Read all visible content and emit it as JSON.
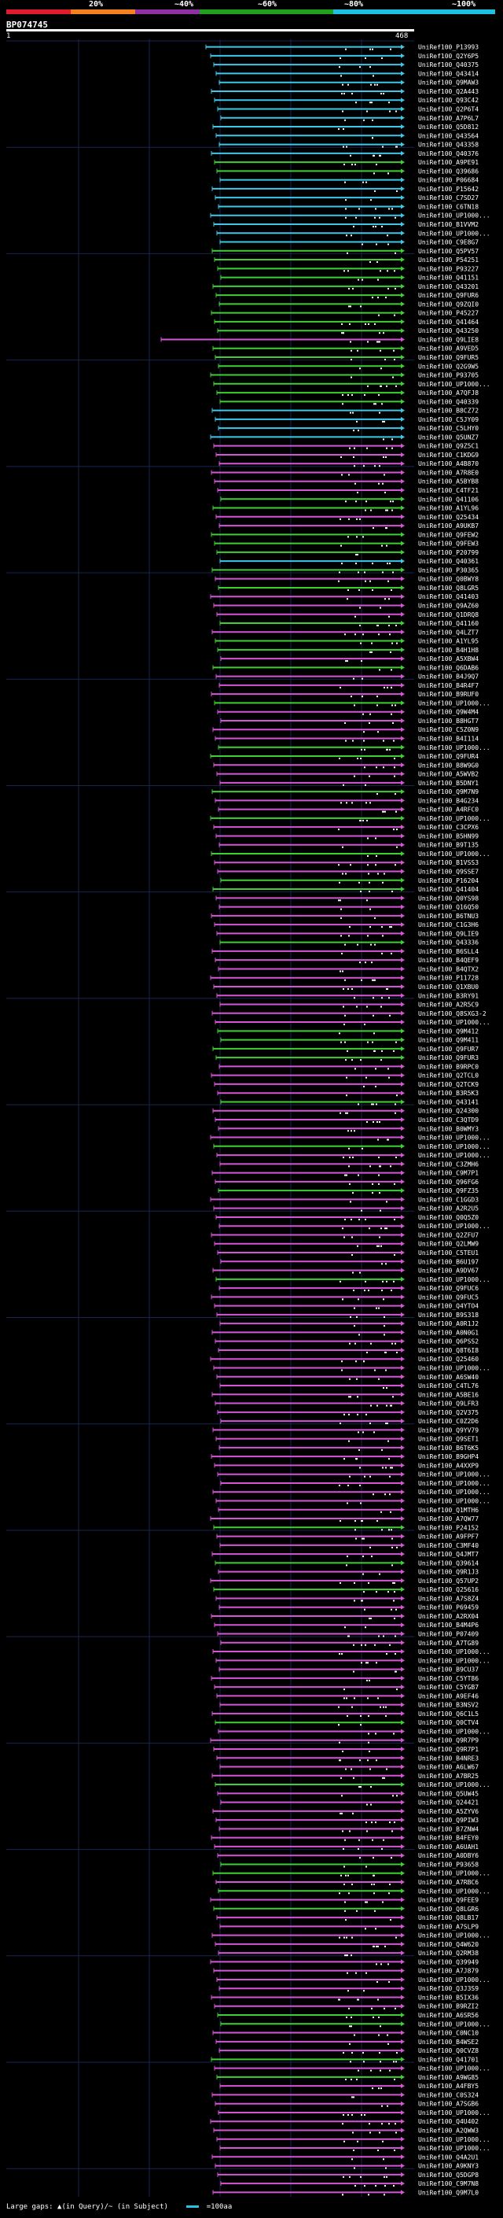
{
  "header": {
    "scale": [
      {
        "label": "20%",
        "color": "#e01b2c"
      },
      {
        "label": "~40%",
        "color": "#f58020"
      },
      {
        "label": "~60%",
        "color": "#8e2fa3"
      },
      {
        "label": "~80%",
        "color": "#1fa01f"
      },
      {
        "label": "~100%",
        "color": "#1ec0e0"
      }
    ],
    "title": "BP074745",
    "ruler_start": "1",
    "ruler_end": "468"
  },
  "colors": {
    "cyan": "#3cc8e8",
    "green": "#3ecf32",
    "magenta": "#d654d6",
    "background": "#000000",
    "grid": "#1a2550"
  },
  "legend": {
    "large_gaps": "Large gaps: ▲(in Query)/~ (in Subject)",
    "scale_text": "=100aa"
  },
  "hits": [
    {
      "label": "UniRef100_P13993",
      "c": "cyan"
    },
    {
      "label": "UniRef100_Q2Y6P5",
      "c": "cyan"
    },
    {
      "label": "UniRef100_Q40375",
      "c": "cyan"
    },
    {
      "label": "UniRef100_Q43414",
      "c": "cyan"
    },
    {
      "label": "UniRef100_Q9MAW3",
      "c": "cyan"
    },
    {
      "label": "UniRef100_Q2A443",
      "c": "cyan"
    },
    {
      "label": "UniRef100_Q93C42",
      "c": "cyan"
    },
    {
      "label": "UniRef100_Q2P6T4",
      "c": "cyan"
    },
    {
      "label": "UniRef100_A7P6L7",
      "c": "cyan"
    },
    {
      "label": "UniRef100_Q5D812",
      "c": "cyan"
    },
    {
      "label": "UniRef100_Q43564",
      "c": "cyan"
    },
    {
      "label": "UniRef100_Q43358",
      "c": "cyan"
    },
    {
      "label": "UniRef100_Q40376",
      "c": "cyan"
    },
    {
      "label": "UniRef100_A9PE91",
      "c": "green"
    },
    {
      "label": "UniRef100_Q39686",
      "c": "green"
    },
    {
      "label": "UniRef100_P06684",
      "c": "cyan"
    },
    {
      "label": "UniRef100_P15642",
      "c": "cyan"
    },
    {
      "label": "UniRef100_C7SD27",
      "c": "cyan"
    },
    {
      "label": "UniRef100_C6TN18",
      "c": "cyan"
    },
    {
      "label": "UniRef100_UP1000...",
      "c": "cyan"
    },
    {
      "label": "UniRef100_B1VVM2",
      "c": "cyan"
    },
    {
      "label": "UniRef100_UP1000...",
      "c": "cyan"
    },
    {
      "label": "UniRef100_C9E8G7",
      "c": "cyan"
    },
    {
      "label": "UniRef100_Q5PV57",
      "c": "green"
    },
    {
      "label": "UniRef100_P54251",
      "c": "green"
    },
    {
      "label": "UniRef100_P93227",
      "c": "green"
    },
    {
      "label": "UniRef100_Q41151",
      "c": "green"
    },
    {
      "label": "UniRef100_Q43201",
      "c": "green"
    },
    {
      "label": "UniRef100_Q9FUR6",
      "c": "green"
    },
    {
      "label": "UniRef100_Q9ZQI0",
      "c": "green"
    },
    {
      "label": "UniRef100_P45227",
      "c": "green"
    },
    {
      "label": "UniRef100_Q41464",
      "c": "green"
    },
    {
      "label": "UniRef100_Q43250",
      "c": "green"
    },
    {
      "label": "UniRef100_Q9LIE8",
      "c": "magenta"
    },
    {
      "label": "UniRef100_A9VED5",
      "c": "green"
    },
    {
      "label": "UniRef100_Q9FUR5",
      "c": "green"
    },
    {
      "label": "UniRef100_Q2G9W5",
      "c": "green"
    },
    {
      "label": "UniRef100_P93705",
      "c": "green"
    },
    {
      "label": "UniRef100_UP1000...",
      "c": "green"
    },
    {
      "label": "UniRef100_A7QFJ8",
      "c": "green"
    },
    {
      "label": "UniRef100_Q40339",
      "c": "green"
    },
    {
      "label": "UniRef100_B8CZ72",
      "c": "cyan"
    },
    {
      "label": "UniRef100_C5JY09",
      "c": "cyan"
    },
    {
      "label": "UniRef100_C5LHY0",
      "c": "cyan"
    },
    {
      "label": "UniRef100_Q5UNZ7",
      "c": "cyan"
    },
    {
      "label": "UniRef100_Q9Z5C1",
      "c": "magenta"
    },
    {
      "label": "UniRef100_C1KDG9",
      "c": "magenta"
    },
    {
      "label": "UniRef100_A4B870",
      "c": "magenta"
    },
    {
      "label": "UniRef100_A7R8E0",
      "c": "magenta"
    },
    {
      "label": "UniRef100_A5BYB8",
      "c": "magenta"
    },
    {
      "label": "UniRef100_C4TF21",
      "c": "magenta"
    },
    {
      "label": "UniRef100_Q41106",
      "c": "green"
    },
    {
      "label": "UniRef100_A1YL96",
      "c": "green"
    },
    {
      "label": "UniRef100_Q25434",
      "c": "magenta"
    },
    {
      "label": "UniRef100_A9UKB7",
      "c": "magenta"
    },
    {
      "label": "UniRef100_Q9FEW2",
      "c": "green"
    },
    {
      "label": "UniRef100_Q9FEW3",
      "c": "green"
    },
    {
      "label": "UniRef100_P20799",
      "c": "green"
    },
    {
      "label": "UniRef100_Q40361",
      "c": "cyan"
    },
    {
      "label": "UniRef100_P30365",
      "c": "green"
    },
    {
      "label": "UniRef100_Q0BWY8",
      "c": "magenta"
    },
    {
      "label": "UniRef100_Q8LGR5",
      "c": "green"
    },
    {
      "label": "UniRef100_Q41403",
      "c": "magenta"
    },
    {
      "label": "UniRef100_Q9AZ60",
      "c": "magenta"
    },
    {
      "label": "UniRef100_Q1DRQ8",
      "c": "magenta"
    },
    {
      "label": "UniRef100_Q41160",
      "c": "green"
    },
    {
      "label": "UniRef100_Q4LZT7",
      "c": "magenta"
    },
    {
      "label": "UniRef100_A1YL95",
      "c": "green"
    },
    {
      "label": "UniRef100_B4H1H8",
      "c": "green"
    },
    {
      "label": "UniRef100_A5XBW4",
      "c": "magenta"
    },
    {
      "label": "UniRef100_Q6DAB6",
      "c": "green"
    },
    {
      "label": "UniRef100_B4J9Q7",
      "c": "magenta"
    },
    {
      "label": "UniRef100_B4R4F7",
      "c": "magenta"
    },
    {
      "label": "UniRef100_B9RUF0",
      "c": "magenta"
    },
    {
      "label": "UniRef100_UP1000...",
      "c": "green"
    },
    {
      "label": "UniRef100_Q9W4M4",
      "c": "magenta"
    },
    {
      "label": "UniRef100_B8HGT7",
      "c": "magenta"
    },
    {
      "label": "UniRef100_C5Z0N9",
      "c": "magenta"
    },
    {
      "label": "UniRef100_B4I114",
      "c": "magenta"
    },
    {
      "label": "UniRef100_UP1000...",
      "c": "green"
    },
    {
      "label": "UniRef100_Q9FUR4",
      "c": "green"
    },
    {
      "label": "UniRef100_B8W9G0",
      "c": "magenta"
    },
    {
      "label": "UniRef100_A5WVB2",
      "c": "magenta"
    },
    {
      "label": "UniRef100_B5DNY1",
      "c": "magenta"
    },
    {
      "label": "UniRef100_Q9M7N9",
      "c": "green"
    },
    {
      "label": "UniRef100_B4G234",
      "c": "magenta"
    },
    {
      "label": "UniRef100_A4RFC0",
      "c": "magenta"
    },
    {
      "label": "UniRef100_UP1000...",
      "c": "green"
    },
    {
      "label": "UniRef100_C3CPX6",
      "c": "magenta"
    },
    {
      "label": "UniRef100_B5HN99",
      "c": "magenta"
    },
    {
      "label": "UniRef100_B9T135",
      "c": "magenta"
    },
    {
      "label": "UniRef100_UP1000...",
      "c": "green"
    },
    {
      "label": "UniRef100_B1VSS3",
      "c": "magenta"
    },
    {
      "label": "UniRef100_Q9SSE7",
      "c": "magenta"
    },
    {
      "label": "UniRef100_P16204",
      "c": "green"
    },
    {
      "label": "UniRef100_Q41404",
      "c": "green"
    },
    {
      "label": "UniRef100_Q0YS98",
      "c": "magenta"
    },
    {
      "label": "UniRef100_Q16Q50",
      "c": "magenta"
    },
    {
      "label": "UniRef100_B6TNU3",
      "c": "magenta"
    },
    {
      "label": "UniRef100_C1G3H6",
      "c": "magenta"
    },
    {
      "label": "UniRef100_Q9LIE9",
      "c": "magenta"
    },
    {
      "label": "UniRef100_Q43336",
      "c": "green"
    },
    {
      "label": "UniRef100_B6SLL4",
      "c": "magenta"
    },
    {
      "label": "UniRef100_B4QEF9",
      "c": "magenta"
    },
    {
      "label": "UniRef100_B4QTX2",
      "c": "magenta"
    },
    {
      "label": "UniRef100_P11728",
      "c": "magenta"
    },
    {
      "label": "UniRef100_Q1XBU0",
      "c": "magenta"
    },
    {
      "label": "UniRef100_B3RY91",
      "c": "magenta"
    },
    {
      "label": "UniRef100_A2R5C9",
      "c": "magenta"
    },
    {
      "label": "UniRef100_Q8SXG3-2",
      "c": "magenta"
    },
    {
      "label": "UniRef100_UP1000...",
      "c": "magenta"
    },
    {
      "label": "UniRef100_Q9M412",
      "c": "green"
    },
    {
      "label": "UniRef100_Q9M411",
      "c": "green"
    },
    {
      "label": "UniRef100_Q9FUR7",
      "c": "green"
    },
    {
      "label": "UniRef100_Q9FUR3",
      "c": "green"
    },
    {
      "label": "UniRef100_B9RPC0",
      "c": "magenta"
    },
    {
      "label": "UniRef100_Q2TCL0",
      "c": "magenta"
    },
    {
      "label": "UniRef100_Q2TCK9",
      "c": "magenta"
    },
    {
      "label": "UniRef100_B3R5K3",
      "c": "magenta"
    },
    {
      "label": "UniRef100_Q43141",
      "c": "green"
    },
    {
      "label": "UniRef100_Q24300",
      "c": "magenta"
    },
    {
      "label": "UniRef100_C3QTD9",
      "c": "magenta"
    },
    {
      "label": "UniRef100_B0WMY3",
      "c": "magenta"
    },
    {
      "label": "UniRef100_UP1000...",
      "c": "magenta"
    },
    {
      "label": "UniRef100_UP1000...",
      "c": "green"
    },
    {
      "label": "UniRef100_UP1000...",
      "c": "magenta"
    },
    {
      "label": "UniRef100_C3ZMH6",
      "c": "magenta"
    },
    {
      "label": "UniRef100_C9M7P1",
      "c": "magenta"
    },
    {
      "label": "UniRef100_Q96FG6",
      "c": "magenta"
    },
    {
      "label": "UniRef100_Q9FZ35",
      "c": "green"
    },
    {
      "label": "UniRef100_C1GGD3",
      "c": "magenta"
    },
    {
      "label": "UniRef100_A2R2U5",
      "c": "magenta"
    },
    {
      "label": "UniRef100_Q0Q5Z0",
      "c": "magenta"
    },
    {
      "label": "UniRef100_UP1000...",
      "c": "magenta"
    },
    {
      "label": "UniRef100_Q2ZFU7",
      "c": "magenta"
    },
    {
      "label": "UniRef100_Q2LMW9",
      "c": "magenta"
    },
    {
      "label": "UniRef100_C5TEU1",
      "c": "magenta"
    },
    {
      "label": "UniRef100_B6U197",
      "c": "magenta"
    },
    {
      "label": "UniRef100_A9DV67",
      "c": "magenta"
    },
    {
      "label": "UniRef100_UP1000...",
      "c": "green"
    },
    {
      "label": "UniRef100_Q9FUC6",
      "c": "magenta"
    },
    {
      "label": "UniRef100_Q9FUC5",
      "c": "magenta"
    },
    {
      "label": "UniRef100_Q4YTO4",
      "c": "magenta"
    },
    {
      "label": "UniRef100_B9S318",
      "c": "magenta"
    },
    {
      "label": "UniRef100_A0R1J2",
      "c": "magenta"
    },
    {
      "label": "UniRef100_A0N0G1",
      "c": "magenta"
    },
    {
      "label": "UniRef100_Q6PSS2",
      "c": "magenta"
    },
    {
      "label": "UniRef100_Q8T6I8",
      "c": "magenta"
    },
    {
      "label": "UniRef100_Q25460",
      "c": "magenta"
    },
    {
      "label": "UniRef100_UP1000...",
      "c": "magenta"
    },
    {
      "label": "UniRef100_A6SW40",
      "c": "magenta"
    },
    {
      "label": "UniRef100_C4TL76",
      "c": "magenta"
    },
    {
      "label": "UniRef100_A5BE16",
      "c": "magenta"
    },
    {
      "label": "UniRef100_Q9LFR3",
      "c": "magenta"
    },
    {
      "label": "UniRef100_Q2V375",
      "c": "magenta"
    },
    {
      "label": "UniRef100_C0Z2D6",
      "c": "magenta"
    },
    {
      "label": "UniRef100_Q9YV79",
      "c": "magenta"
    },
    {
      "label": "UniRef100_Q9SET1",
      "c": "magenta"
    },
    {
      "label": "UniRef100_B6T6K5",
      "c": "magenta"
    },
    {
      "label": "UniRef100_B9GHP4",
      "c": "magenta"
    },
    {
      "label": "UniRef100_A4XXP9",
      "c": "magenta"
    },
    {
      "label": "UniRef100_UP1000...",
      "c": "magenta"
    },
    {
      "label": "UniRef100_UP1000...",
      "c": "magenta"
    },
    {
      "label": "UniRef100_UP1000...",
      "c": "magenta"
    },
    {
      "label": "UniRef100_UP1000...",
      "c": "magenta"
    },
    {
      "label": "UniRef100_Q1MTH6",
      "c": "magenta"
    },
    {
      "label": "UniRef100_A7QW77",
      "c": "magenta"
    },
    {
      "label": "UniRef100_P24152",
      "c": "green"
    },
    {
      "label": "UniRef100_A9FPF7",
      "c": "magenta"
    },
    {
      "label": "UniRef100_C3MF40",
      "c": "magenta"
    },
    {
      "label": "UniRef100_Q4JMT7",
      "c": "magenta"
    },
    {
      "label": "UniRef100_Q39614",
      "c": "green"
    },
    {
      "label": "UniRef100_Q9R1J3",
      "c": "magenta"
    },
    {
      "label": "UniRef100_Q57UP2",
      "c": "magenta"
    },
    {
      "label": "UniRef100_Q25616",
      "c": "green"
    },
    {
      "label": "UniRef100_A7S8Z4",
      "c": "magenta"
    },
    {
      "label": "UniRef100_P69459",
      "c": "magenta"
    },
    {
      "label": "UniRef100_A2RX04",
      "c": "magenta"
    },
    {
      "label": "UniRef100_B4M4P6",
      "c": "magenta"
    },
    {
      "label": "UniRef100_P07409",
      "c": "magenta"
    },
    {
      "label": "UniRef100_A7TG89",
      "c": "magenta"
    },
    {
      "label": "UniRef100_UP1000...",
      "c": "magenta"
    },
    {
      "label": "UniRef100_UP1000...",
      "c": "magenta"
    },
    {
      "label": "UniRef100_B9CU37",
      "c": "magenta"
    },
    {
      "label": "UniRef100_C5YT86",
      "c": "magenta"
    },
    {
      "label": "UniRef100_C5YGB7",
      "c": "magenta"
    },
    {
      "label": "UniRef100_A9EF46",
      "c": "magenta"
    },
    {
      "label": "UniRef100_B3NSV2",
      "c": "magenta"
    },
    {
      "label": "UniRef100_Q6C1L5",
      "c": "magenta"
    },
    {
      "label": "UniRef100_Q0CTV4",
      "c": "green"
    },
    {
      "label": "UniRef100_UP1000...",
      "c": "magenta"
    },
    {
      "label": "UniRef100_Q9R7P9",
      "c": "magenta"
    },
    {
      "label": "UniRef100_Q9R7P1",
      "c": "magenta"
    },
    {
      "label": "UniRef100_B4NRE3",
      "c": "magenta"
    },
    {
      "label": "UniRef100_A6LW67",
      "c": "magenta"
    },
    {
      "label": "UniRef100_A7BR25",
      "c": "magenta"
    },
    {
      "label": "UniRef100_UP1000...",
      "c": "green"
    },
    {
      "label": "UniRef100_Q5UW45",
      "c": "magenta"
    },
    {
      "label": "UniRef100_Q24421",
      "c": "magenta"
    },
    {
      "label": "UniRef100_A5ZYV6",
      "c": "magenta"
    },
    {
      "label": "UniRef100_Q9PIW3",
      "c": "magenta"
    },
    {
      "label": "UniRef100_B7ZNW4",
      "c": "magenta"
    },
    {
      "label": "UniRef100_B4FEY0",
      "c": "magenta"
    },
    {
      "label": "UniRef100_A6UAH1",
      "c": "magenta"
    },
    {
      "label": "UniRef100_A0DBY6",
      "c": "magenta"
    },
    {
      "label": "UniRef100_P93658",
      "c": "green"
    },
    {
      "label": "UniRef100_UP1000...",
      "c": "green"
    },
    {
      "label": "UniRef100_A7RBC6",
      "c": "magenta"
    },
    {
      "label": "UniRef100_UP1000...",
      "c": "green"
    },
    {
      "label": "UniRef100_Q9FEE9",
      "c": "magenta"
    },
    {
      "label": "UniRef100_Q8LGR6",
      "c": "green"
    },
    {
      "label": "UniRef100_Q8LB17",
      "c": "magenta"
    },
    {
      "label": "UniRef100_A7SLP9",
      "c": "magenta"
    },
    {
      "label": "UniRef100_UP1000...",
      "c": "magenta"
    },
    {
      "label": "UniRef100_Q4W620",
      "c": "magenta"
    },
    {
      "label": "UniRef100_Q2RM38",
      "c": "magenta"
    },
    {
      "label": "UniRef100_Q39949",
      "c": "magenta"
    },
    {
      "label": "UniRef100_A7J879",
      "c": "magenta"
    },
    {
      "label": "UniRef100_UP1000...",
      "c": "magenta"
    },
    {
      "label": "UniRef100_Q3J3S9",
      "c": "magenta"
    },
    {
      "label": "UniRef100_B5IX36",
      "c": "magenta"
    },
    {
      "label": "UniRef100_B9RZI2",
      "c": "magenta"
    },
    {
      "label": "UniRef100_A6SR56",
      "c": "green"
    },
    {
      "label": "UniRef100_UP1000...",
      "c": "green"
    },
    {
      "label": "UniRef100_C0NC10",
      "c": "magenta"
    },
    {
      "label": "UniRef100_B4WSE2",
      "c": "magenta"
    },
    {
      "label": "UniRef100_Q0CVZ8",
      "c": "magenta"
    },
    {
      "label": "UniRef100_Q41701",
      "c": "green"
    },
    {
      "label": "UniRef100_UP1000...",
      "c": "magenta"
    },
    {
      "label": "UniRef100_A9WG85",
      "c": "green"
    },
    {
      "label": "UniRef100_A4FBY5",
      "c": "magenta"
    },
    {
      "label": "UniRef100_C0S324",
      "c": "magenta"
    },
    {
      "label": "UniRef100_A7SGB6",
      "c": "magenta"
    },
    {
      "label": "UniRef100_UP1000...",
      "c": "magenta"
    },
    {
      "label": "UniRef100_Q4U402",
      "c": "magenta"
    },
    {
      "label": "UniRef100_A2QWW3",
      "c": "magenta"
    },
    {
      "label": "UniRef100_UP1000...",
      "c": "magenta"
    },
    {
      "label": "UniRef100_UP1000...",
      "c": "magenta"
    },
    {
      "label": "UniRef100_Q4A2U1",
      "c": "magenta"
    },
    {
      "label": "UniRef100_A9KNY3",
      "c": "magenta"
    },
    {
      "label": "UniRef100_Q5DGP8",
      "c": "magenta"
    },
    {
      "label": "UniRef100_C9M7N8",
      "c": "magenta"
    },
    {
      "label": "UniRef100_Q9M7L0",
      "c": "magenta"
    }
  ]
}
